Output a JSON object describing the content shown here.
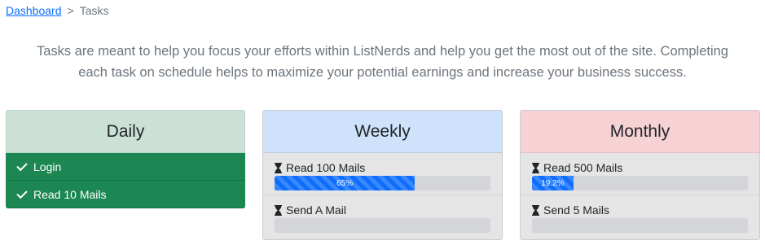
{
  "breadcrumb": {
    "root": "Dashboard",
    "separator": ">",
    "current": "Tasks"
  },
  "intro": {
    "line1": "Tasks are meant to help you focus your efforts within ListNerds and help you get the most out of the site. Completing",
    "line2": "each task on schedule helps to maximize your potential earnings and increase your business success."
  },
  "colors": {
    "daily_header": "#cbe1d6",
    "daily_done": "#1d8754",
    "weekly_header": "#cfe2fb",
    "monthly_header": "#f6d2d5",
    "progress": "#0d6efd"
  },
  "daily": {
    "title": "Daily",
    "items": [
      {
        "label": "Login",
        "icon": "check-icon"
      },
      {
        "label": "Read 10 Mails",
        "icon": "check-icon"
      }
    ]
  },
  "weekly": {
    "title": "Weekly",
    "tasks": [
      {
        "label": "Read 100 Mails",
        "icon": "hourglass-icon",
        "progress": 65,
        "progress_label": "65%"
      },
      {
        "label": "Send A Mail",
        "icon": "hourglass-icon",
        "progress": 0,
        "progress_label": ""
      }
    ]
  },
  "monthly": {
    "title": "Monthly",
    "tasks": [
      {
        "label": "Read 500 Mails",
        "icon": "hourglass-icon",
        "progress": 19.2,
        "progress_label": "19.2%"
      },
      {
        "label": "Send 5 Mails",
        "icon": "hourglass-icon",
        "progress": 0,
        "progress_label": ""
      }
    ]
  }
}
